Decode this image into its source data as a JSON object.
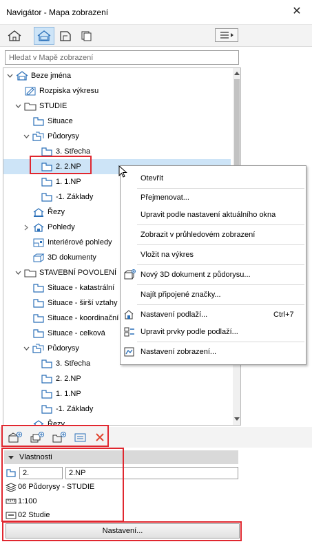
{
  "window": {
    "title": "Navigátor - Mapa zobrazení"
  },
  "search": {
    "placeholder": "Hledat v Mapě zobrazení"
  },
  "tree": {
    "rows": [
      {
        "label": "Beze jména",
        "icon": "house-icon"
      },
      {
        "label": "Rozpiska výkresu",
        "icon": "edit-document-icon"
      },
      {
        "label": "STUDIE",
        "icon": "folder-icon"
      },
      {
        "label": "Situace",
        "icon": "floorplan-icon"
      },
      {
        "label": "Půdorysy",
        "icon": "floorplan-folder-icon"
      },
      {
        "label": "3. Střecha",
        "icon": "floorplan-icon"
      },
      {
        "label": "2. 2.NP",
        "icon": "floorplan-icon"
      },
      {
        "label": "1. 1.NP",
        "icon": "floorplan-icon"
      },
      {
        "label": "-1. Základy",
        "icon": "floorplan-icon"
      },
      {
        "label": "Řezy",
        "icon": "section-icon"
      },
      {
        "label": "Pohledy",
        "icon": "elevation-icon"
      },
      {
        "label": "Interiérové pohledy",
        "icon": "interior-elevation-icon"
      },
      {
        "label": "3D dokumenty",
        "icon": "document-3d-icon"
      },
      {
        "label": "STAVEBNÍ POVOLENÍ",
        "icon": "folder-icon"
      },
      {
        "label": "Situace - katastrální",
        "icon": "floorplan-icon"
      },
      {
        "label": "Situace - širší vztahy",
        "icon": "floorplan-icon"
      },
      {
        "label": "Situace - koordinační",
        "icon": "floorplan-icon"
      },
      {
        "label": "Situace -  celková",
        "icon": "floorplan-icon"
      },
      {
        "label": "Půdorysy",
        "icon": "floorplan-folder-icon"
      },
      {
        "label": "3. Střecha",
        "icon": "floorplan-icon"
      },
      {
        "label": "2. 2.NP",
        "icon": "floorplan-icon"
      },
      {
        "label": "1. 1.NP",
        "icon": "floorplan-icon"
      },
      {
        "label": "-1. Základy",
        "icon": "floorplan-icon"
      },
      {
        "label": "Řezy",
        "icon": "section-icon"
      }
    ]
  },
  "context_menu": {
    "items": [
      {
        "label": "Otevřít",
        "shortcut": ""
      },
      {
        "label": "Přejmenovat...",
        "shortcut": ""
      },
      {
        "label": "Upravit podle nastavení aktuálního okna",
        "shortcut": ""
      },
      {
        "label": "Zobrazit v průhledovém zobrazení",
        "shortcut": ""
      },
      {
        "label": "Vložit na výkres",
        "shortcut": ""
      },
      {
        "label": "Nový 3D dokument z půdorysu...",
        "shortcut": ""
      },
      {
        "label": "Najít připojené značky...",
        "shortcut": ""
      },
      {
        "label": "Nastavení podlaží...",
        "shortcut": "Ctrl+7"
      },
      {
        "label": "Upravit prvky podle podlaží...",
        "shortcut": ""
      },
      {
        "label": "Nastavení zobrazení...",
        "shortcut": ""
      }
    ]
  },
  "properties": {
    "title": "Vlastnosti",
    "id_value": "2.",
    "name_value": "2.NP",
    "layer_combination": "06 Půdorysy - STUDIE",
    "scale": "1:100",
    "pen_set": "02 Studie"
  },
  "settings_button": {
    "label": "Nastavení..."
  },
  "colors": {
    "selection": "#cde4f7",
    "highlight": "#e0272f",
    "icon_blue": "#2a6fb8",
    "delete_red": "#e0442f"
  }
}
